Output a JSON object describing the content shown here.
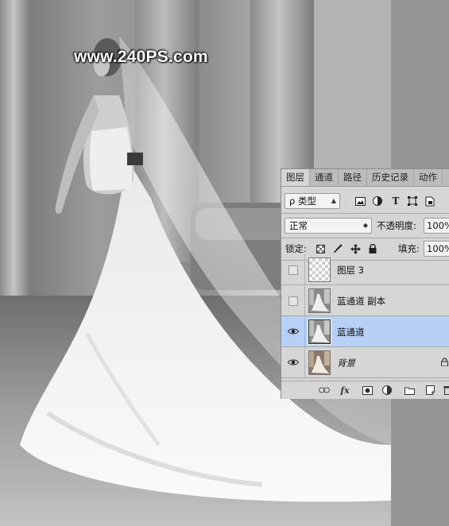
{
  "watermark": "www.240PS.com",
  "layers_panel": {
    "tabs": [
      "图层",
      "通道",
      "路径",
      "历史记录",
      "动作"
    ],
    "active_tab": "图层",
    "filter": {
      "label": "ρ 类型",
      "icons": [
        "image-filter-icon",
        "adjustment-filter-icon",
        "type-filter-icon",
        "shape-filter-icon",
        "smart-object-filter-icon"
      ]
    },
    "blend_mode": "正常",
    "opacity_label": "不透明度:",
    "opacity_value": "100%",
    "lock_label": "锁定:",
    "lock_icons": [
      "lock-transparent-icon",
      "lock-paint-icon",
      "lock-move-icon",
      "lock-all-icon"
    ],
    "fill_label": "填充:",
    "fill_value": "100%",
    "layers": [
      {
        "name": "图层 3",
        "visible": false,
        "selected": false,
        "italic": false,
        "thumb": "transparent"
      },
      {
        "name": "蓝通道 副本",
        "visible": false,
        "selected": false,
        "italic": false,
        "thumb": "grayscale-photo"
      },
      {
        "name": "蓝通道",
        "visible": true,
        "selected": true,
        "italic": false,
        "thumb": "grayscale-photo"
      },
      {
        "name": "背景",
        "visible": true,
        "selected": false,
        "italic": true,
        "thumb": "color-photo",
        "locked": true
      }
    ],
    "bottom_icons": [
      "link-layers-icon",
      "fx-icon",
      "add-mask-icon",
      "new-adjustment-icon",
      "new-group-icon",
      "new-layer-icon",
      "delete-layer-icon"
    ],
    "fx_label": "fx"
  },
  "colors": {
    "selected_row": "#b6d0f6",
    "panel_bg": "#d6d6d6"
  }
}
